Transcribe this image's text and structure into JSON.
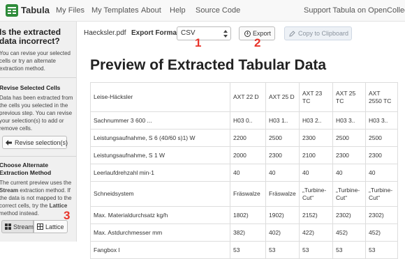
{
  "navbar": {
    "brand": "Tabula",
    "links": [
      "My Files",
      "My Templates",
      "About",
      "Help",
      "Source Code"
    ],
    "support": "Support Tabula on OpenCollective!"
  },
  "sidebar": {
    "title": "Is the extracted data incorrect?",
    "intro": "You can revise your selected cells or try an alternate extraction method.",
    "revise_heading": "Revise Selected Cells",
    "revise_text": "Data has been extracted from the cells you selected in the previous step. You can revise your selection(s) to add or remove cells.",
    "revise_button": "Revise selection(s)",
    "alt_heading": "Choose Alternate Extraction Method",
    "alt_text_1": "The current preview uses the",
    "alt_method": "Stream",
    "alt_text_2": "extraction method. If the data is not mapped to the correct cells, try the",
    "alt_alt_method": "Lattice",
    "alt_text_3": "method instead.",
    "stream_button": "Stream",
    "lattice_button": "Lattice"
  },
  "toolbar": {
    "filename": "Haecksler.pdf",
    "format_label": "Export Format:",
    "format_value": "CSV",
    "export_button": "Export",
    "copy_button": "Copy to Clipboard"
  },
  "markers": [
    "1",
    "2",
    "3"
  ],
  "main": {
    "title": "Preview of Extracted Tabular Data"
  },
  "table": {
    "rows": [
      [
        "Leise-Häcksler",
        "AXT 22 D",
        "AXT 25 D",
        "AXT 23 TC",
        "AXT 25 TC",
        "AXT 2550 TC"
      ],
      [
        "Sachnummer 3 600 ...",
        "H03 0..",
        "H03 1..",
        "H03 2..",
        "H03 3..",
        "H03 3.."
      ],
      [
        "Leistungsaufnahme, S 6 (40/60 s)1) W",
        "2200",
        "2500",
        "2300",
        "2500",
        "2500"
      ],
      [
        "Leistungsaufnahme, S 1 W",
        "2000",
        "2300",
        "2100",
        "2300",
        "2300"
      ],
      [
        "Leerlaufdrehzahl min-1",
        "40",
        "40",
        "40",
        "40",
        "40"
      ],
      [
        "Schneidsystem",
        "Fräswalze",
        "Fräswalze",
        "„Turbine-Cut“",
        "„Turbine-Cut“",
        "„Turbine-Cut“"
      ],
      [
        "Max. Materialdurchsatz kg/h",
        "1802)",
        "1902)",
        "2152)",
        "2302)",
        "2302)"
      ],
      [
        "Max. Astdurchmesser mm",
        "382)",
        "402)",
        "422)",
        "452)",
        "452)"
      ],
      [
        "Fangbox l",
        "53",
        "53",
        "53",
        "53",
        "53"
      ]
    ]
  },
  "colors": {
    "marker": "#e8342a",
    "brand": "#2e8b3a"
  }
}
